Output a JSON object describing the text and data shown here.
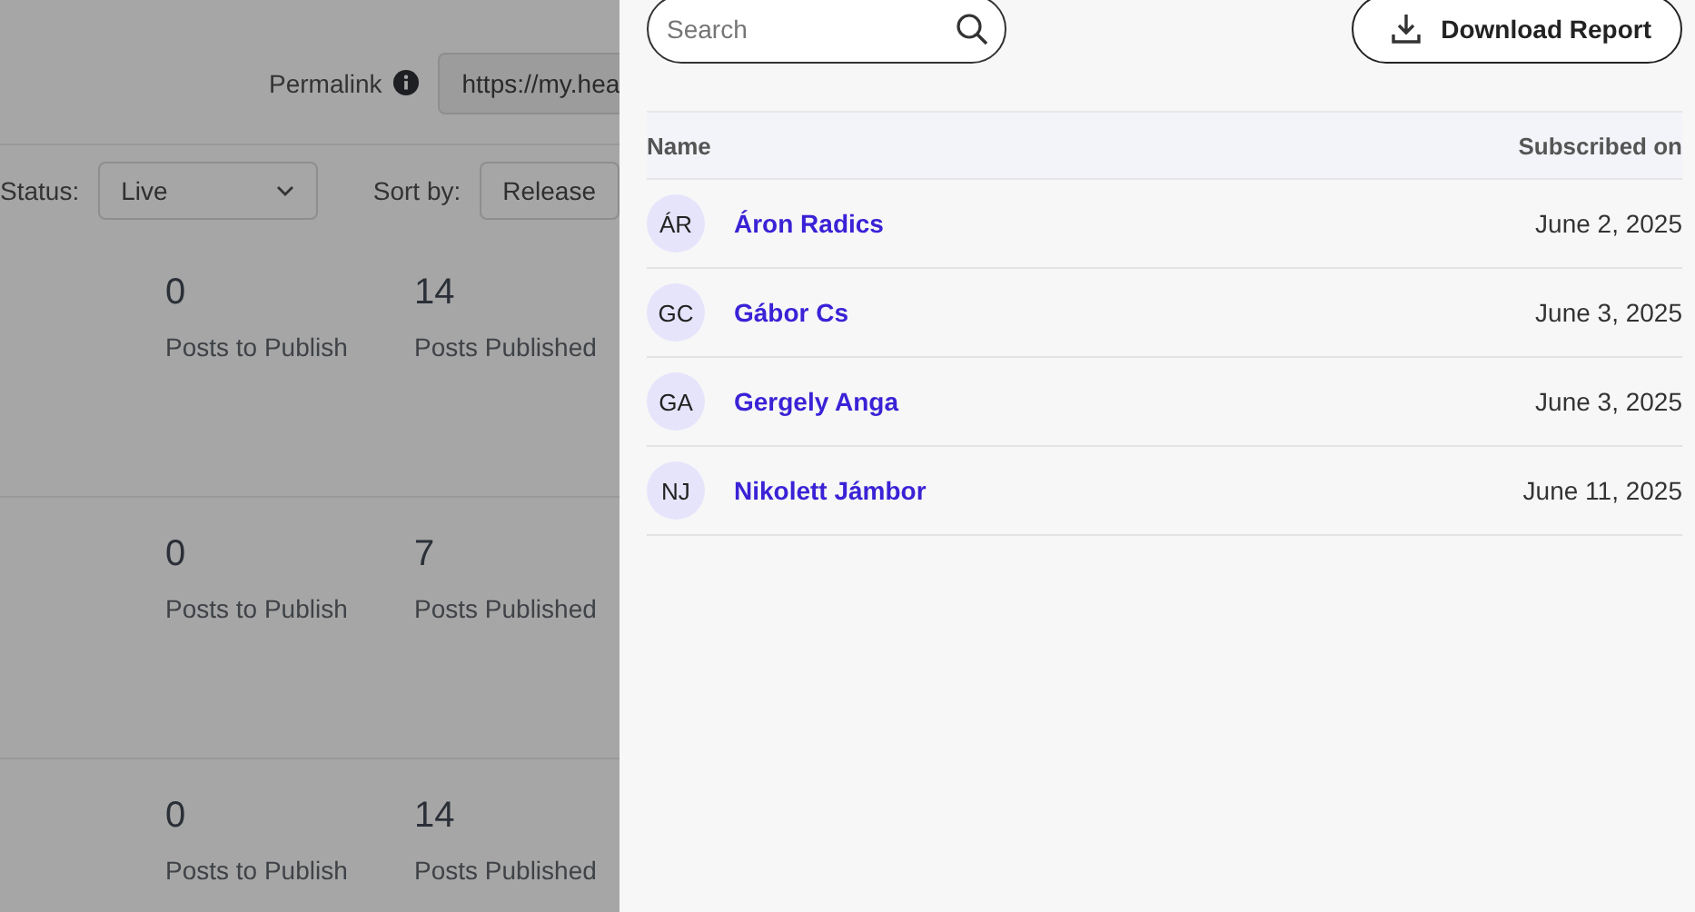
{
  "background_page": {
    "permalink": {
      "label": "Permalink",
      "value": "https://my.hea"
    },
    "filters": [
      {
        "label": "Status:",
        "value": "Live",
        "kind": "dropdown"
      },
      {
        "label": "Sort by:",
        "value": "Release",
        "kind": "field"
      }
    ],
    "cards": [
      {
        "stats": [
          {
            "value": "0",
            "label": "Posts to Publish"
          },
          {
            "value": "14",
            "label": "Posts Published"
          }
        ]
      },
      {
        "stats": [
          {
            "value": "0",
            "label": "Posts to Publish"
          },
          {
            "value": "7",
            "label": "Posts Published"
          }
        ]
      },
      {
        "stats": [
          {
            "value": "0",
            "label": "Posts to Publish"
          },
          {
            "value": "14",
            "label": "Posts Published"
          }
        ]
      }
    ]
  },
  "panel": {
    "search": {
      "placeholder": "Search"
    },
    "download_button": "Download Report",
    "table": {
      "columns": [
        "Name",
        "Subscribed on"
      ],
      "rows": [
        {
          "initials": "ÁR",
          "name": "Áron Radics",
          "date": "June 2, 2025"
        },
        {
          "initials": "GC",
          "name": "Gábor Cs",
          "date": "June 3, 2025"
        },
        {
          "initials": "GA",
          "name": "Gergely Anga",
          "date": "June 3, 2025"
        },
        {
          "initials": "NJ",
          "name": "Nikolett Jámbor",
          "date": "June 11, 2025"
        }
      ]
    }
  }
}
